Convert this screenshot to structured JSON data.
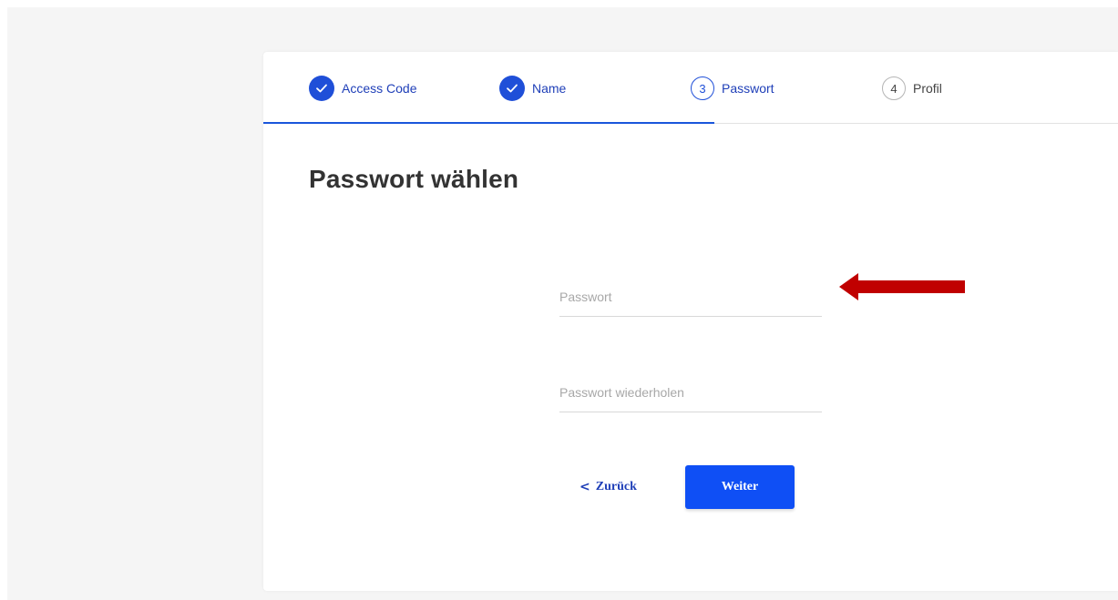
{
  "stepper": {
    "steps": [
      {
        "label": "Access Code",
        "state": "done",
        "icon": "checkmark-icon"
      },
      {
        "label": "Name",
        "state": "done",
        "icon": "checkmark-icon"
      },
      {
        "number": "3",
        "label": "Passwort",
        "state": "current"
      },
      {
        "number": "4",
        "label": "Profil",
        "state": "todo"
      }
    ]
  },
  "form": {
    "title": "Passwort wählen",
    "password_placeholder": "Passwort",
    "password_repeat_placeholder": "Passwort wiederholen",
    "back_label": "Zurück",
    "next_label": "Weiter"
  },
  "colors": {
    "accent": "#1f4fd8",
    "primary_button": "#0f4ff5",
    "annotation_arrow": "#c00000"
  },
  "icons": {
    "back": "chevron-left-icon",
    "annotation": "arrow-left-icon"
  }
}
